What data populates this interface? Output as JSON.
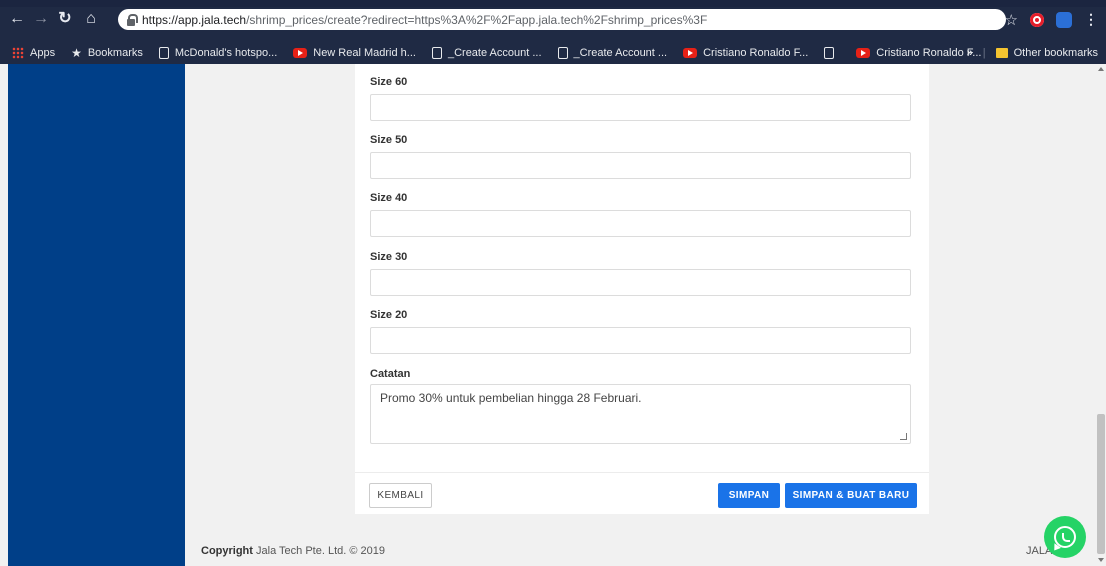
{
  "browser": {
    "url_host": "https://app.jala.tech",
    "url_path": "/shrimp_prices/create?redirect=https%3A%2F%2Fapp.jala.tech%2Fshrimp_prices%3F",
    "bookmarks": [
      {
        "label": "Apps",
        "icon": "apps-grid-icon"
      },
      {
        "label": "Bookmarks",
        "icon": "star-icon"
      },
      {
        "label": "McDonald's hotspo...",
        "icon": "page-icon"
      },
      {
        "label": "New Real Madrid h...",
        "icon": "youtube-icon"
      },
      {
        "label": "_Create Account  ...",
        "icon": "page-icon"
      },
      {
        "label": "_Create Account  ...",
        "icon": "page-icon"
      },
      {
        "label": "Cristiano Ronaldo F...",
        "icon": "youtube-icon"
      },
      {
        "label": "",
        "icon": "page-icon"
      },
      {
        "label": "Cristiano Ronaldo F...",
        "icon": "youtube-icon"
      }
    ],
    "overflow": "»",
    "other_bookmarks": "Other bookmarks"
  },
  "form": {
    "fields": [
      {
        "label": "Size 60",
        "value": ""
      },
      {
        "label": "Size 50",
        "value": ""
      },
      {
        "label": "Size 40",
        "value": ""
      },
      {
        "label": "Size 30",
        "value": ""
      },
      {
        "label": "Size 20",
        "value": ""
      }
    ],
    "notes": {
      "label": "Catatan",
      "value": "Promo 30% untuk pembelian hingga 28 Februari."
    },
    "buttons": {
      "back": "KEMBALI",
      "save": "SIMPAN",
      "save_new": "SIMPAN & BUAT BARU"
    }
  },
  "footer": {
    "copyright_label": "Copyright",
    "copyright_text": "Jala Tech Pte. Ltd. © 2019",
    "right_text": "JALA"
  },
  "colors": {
    "sidebar": "#003f88",
    "primary_button": "#1a73e8",
    "whatsapp": "#25d366"
  }
}
